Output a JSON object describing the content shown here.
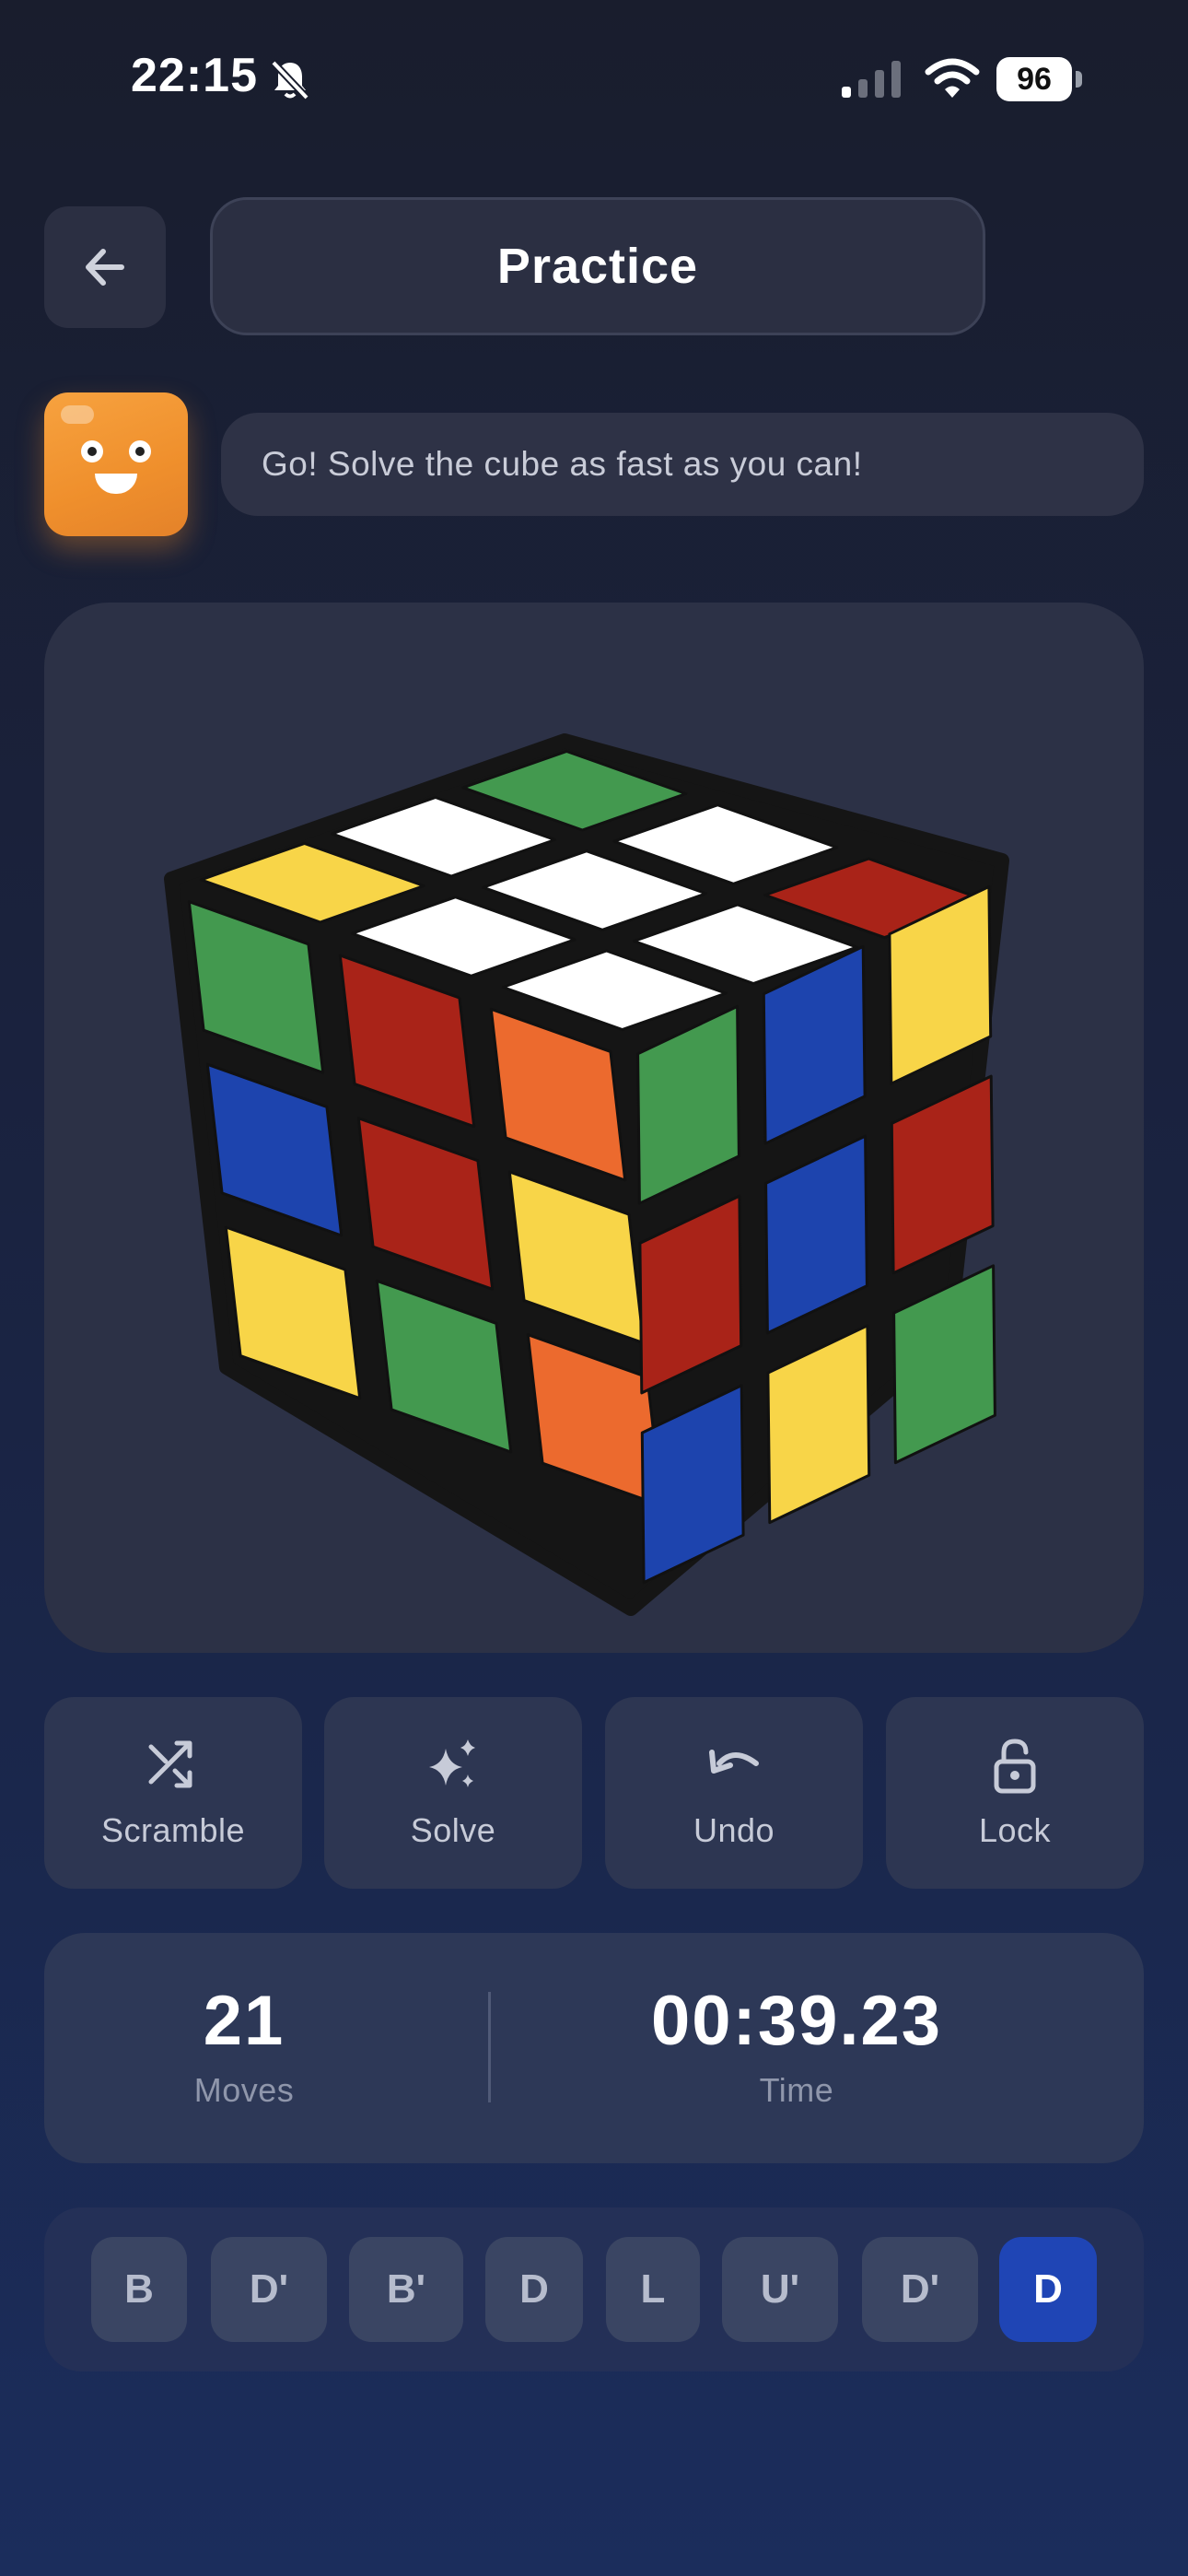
{
  "status_bar": {
    "time": "22:15",
    "battery": "96"
  },
  "header": {
    "title": "Practice"
  },
  "mascot": {
    "message": "Go! Solve the cube as fast as you can!"
  },
  "controls": [
    {
      "label": "Scramble",
      "icon": "shuffle-icon"
    },
    {
      "label": "Solve",
      "icon": "sparkles-icon"
    },
    {
      "label": "Undo",
      "icon": "undo-icon"
    },
    {
      "label": "Lock",
      "icon": "lock-open-icon"
    }
  ],
  "stats": {
    "moves_value": "21",
    "moves_label": "Moves",
    "time_value": "00:39.23",
    "time_label": "Time"
  },
  "move_history": [
    "B",
    "D'",
    "B'",
    "D",
    "L",
    "U'",
    "D'",
    "D"
  ],
  "active_move_index": 7,
  "cube": {
    "top": [
      "yellow",
      "white",
      "green",
      "white",
      "white",
      "white",
      "white",
      "white",
      "red"
    ],
    "left": [
      "green",
      "red",
      "orange",
      "blue",
      "red",
      "yellow",
      "yellow",
      "green",
      "orange"
    ],
    "right": [
      "green",
      "blue",
      "yellow",
      "red",
      "blue",
      "red",
      "blue",
      "yellow",
      "green"
    ]
  },
  "colors": {
    "white": "#ffffff",
    "yellow": "#f8d548",
    "green": "#43994f",
    "red": "#a92318",
    "orange": "#ec6a2e",
    "blue": "#1d44ae",
    "accent": "#1f45b5"
  }
}
